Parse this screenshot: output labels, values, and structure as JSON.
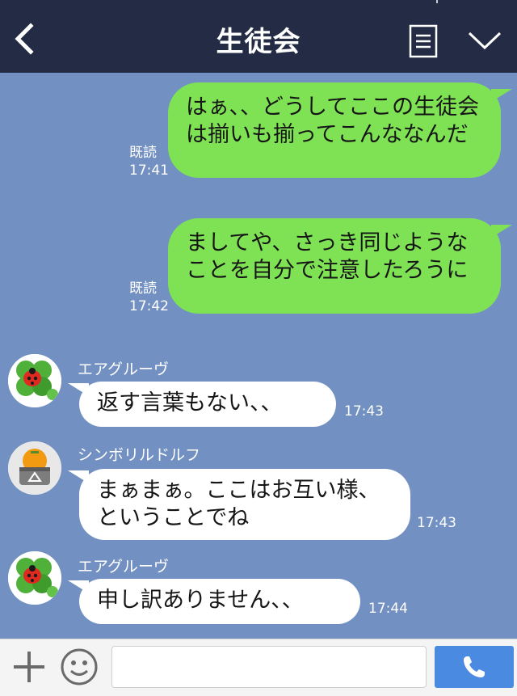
{
  "header": {
    "title": "生徒会"
  },
  "messages": [
    {
      "direction": "outgoing",
      "text": "はぁ、、どうしてここの生徒会は揃いも揃ってこんななんだ",
      "read": "既読",
      "time": "17:41"
    },
    {
      "direction": "outgoing",
      "text": "ましてや、さっき同じようなことを自分で注意したろうに",
      "read": "既読",
      "time": "17:42"
    },
    {
      "direction": "incoming",
      "sender": "エアグルーヴ",
      "avatar": "ladybug-clover-avatar",
      "text": "返す言葉もない、、",
      "time": "17:43"
    },
    {
      "direction": "incoming",
      "sender": "シンボリルドルフ",
      "avatar": "mandarin-orange-avatar",
      "text": "まぁまぁ。ここはお互い様、ということでね",
      "time": "17:43"
    },
    {
      "direction": "incoming",
      "sender": "エアグルーヴ",
      "avatar": "ladybug-clover-avatar",
      "text": "申し訳ありません、、",
      "time": "17:44"
    }
  ],
  "footer": {
    "input_placeholder": "",
    "icons": [
      "plus-icon",
      "emoji-icon",
      "phone-icon"
    ]
  },
  "colors": {
    "header_bg": "#232c44",
    "chat_bg": "#7290c1",
    "outgoing_bubble": "#7fe255",
    "incoming_bubble": "#ffffff",
    "call_button": "#4a8ae0"
  }
}
